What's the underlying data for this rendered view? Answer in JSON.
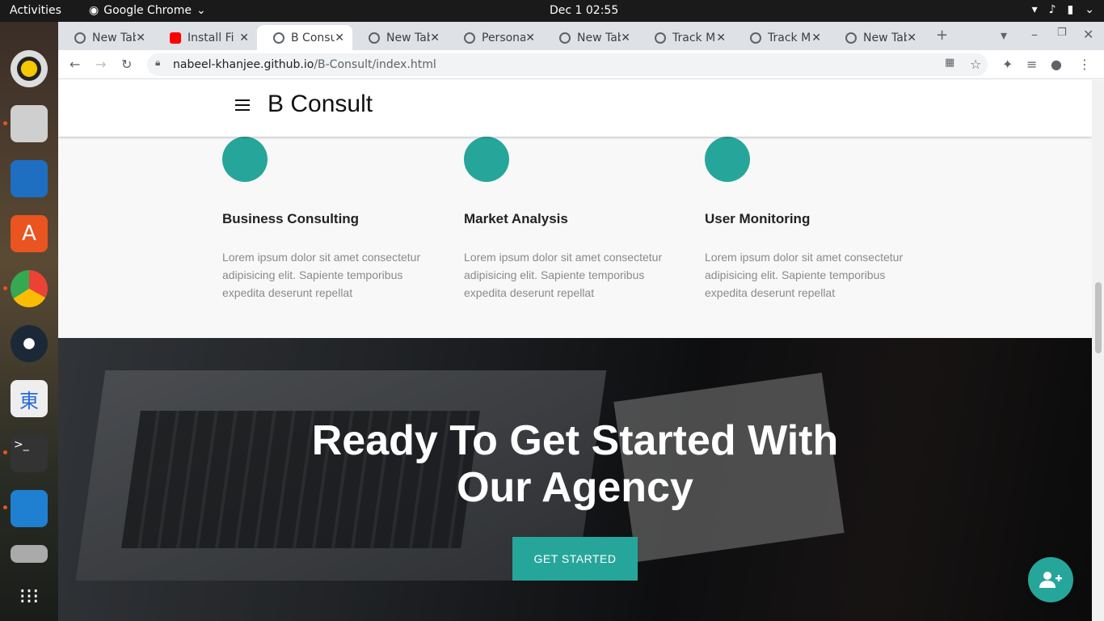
{
  "topbar": {
    "activities": "Activities",
    "app_name": "Google Chrome",
    "clock": "Dec 1  02:55"
  },
  "tabs": [
    {
      "title": "New Tab"
    },
    {
      "title": "Install Fi"
    },
    {
      "title": "B Consult"
    },
    {
      "title": "New Tab"
    },
    {
      "title": "Personal"
    },
    {
      "title": "New Tab"
    },
    {
      "title": "Track M"
    },
    {
      "title": "Track M"
    },
    {
      "title": "New Tab"
    }
  ],
  "address": {
    "host": "nabeel-khanjee.github.io",
    "path": "/B-Consult/index.html"
  },
  "site": {
    "brand": "B Consult"
  },
  "services": [
    {
      "title": "Business Consulting",
      "text": "Lorem ipsum dolor sit amet consectetur adipisicing elit. Sapiente temporibus expedita deserunt repellat"
    },
    {
      "title": "Market Analysis",
      "text": "Lorem ipsum dolor sit amet consectetur adipisicing elit. Sapiente temporibus expedita deserunt repellat"
    },
    {
      "title": "User Monitoring",
      "text": "Lorem ipsum dolor sit amet consectetur adipisicing elit. Sapiente temporibus expedita deserunt repellat"
    }
  ],
  "hero": {
    "title_line1": "Ready To Get Started With",
    "title_line2": "Our Agency",
    "cta": "GET STARTED"
  },
  "colors": {
    "accent": "#26a69a"
  }
}
